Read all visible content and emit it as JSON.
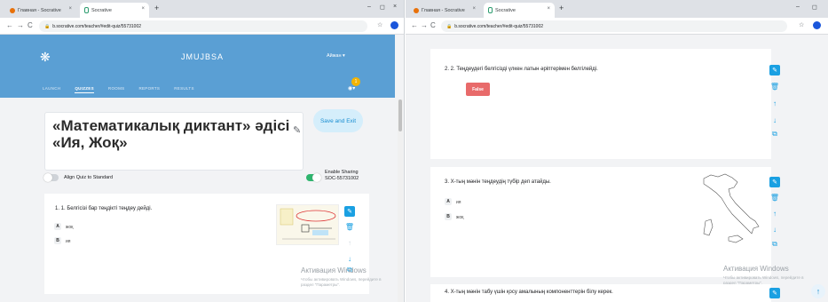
{
  "left": {
    "tabs": [
      {
        "label": "Главная - Socrative",
        "active": false
      },
      {
        "label": "Socrative",
        "active": true
      }
    ],
    "window_controls": {
      "minimize": "–",
      "maximize": "◻",
      "close": "×"
    },
    "url": "b.socrative.com/teacher/#edit-quiz/55731002",
    "header": {
      "brand": "JMUJBSA",
      "user": "Айжан ▾",
      "tabs": [
        "LAUNCH",
        "QUIZZES",
        "ROOMS",
        "REPORTS",
        "RESULTS"
      ],
      "active_tab": "QUIZZES",
      "badge_count": "1"
    },
    "quiz_title_line1": "«Математикалық диктант» әдісі",
    "quiz_title_line2": "«Ия, Жоқ»",
    "save_label": "Save and Exit",
    "align_label": "Align Quiz to Standard",
    "share_label": "Enable Sharing",
    "share_code": "SOC-55731002",
    "question1": {
      "text": "1.  1. Белгісізі бар теңдікті теңдеу дейді.",
      "options": [
        {
          "letter": "A",
          "text": "жоқ"
        },
        {
          "letter": "B",
          "text": "ия"
        }
      ]
    },
    "activation_title": "Активация Windows",
    "activation_sub1": "Чтобы активировать Windows, перейдите в",
    "activation_sub2": "раздел \"Параметры\"."
  },
  "right": {
    "tabs": [
      {
        "label": "Главная - Socrative",
        "active": false
      },
      {
        "label": "Socrative",
        "active": true
      }
    ],
    "url": "b.socrative.com/teacher/#edit-quiz/55731002",
    "question2": {
      "text": "2.  2. Теңдеудегі белгісізді үлкен латын әріптерімен белгілейді.",
      "answer": "False"
    },
    "question3": {
      "text": "3.  Х-тың мәнін теңдеудің түбір деп атайды.",
      "options": [
        {
          "letter": "A",
          "text": "ия"
        },
        {
          "letter": "B",
          "text": "жоқ"
        }
      ]
    },
    "question4": {
      "text": "4.  Х-тың мәнін табу үшін қосу амалының компоненттерін білу керек."
    },
    "activation_title": "Активация Windows",
    "activation_sub1": "Чтобы активировать Windows, перейдите в",
    "activation_sub2": "раздел \"Параметры\"."
  },
  "colors": {
    "header_blue": "#5a9fd4",
    "accent": "#1aa0e2",
    "false_red": "#e86a6a",
    "toggle_green": "#2fb56e"
  }
}
